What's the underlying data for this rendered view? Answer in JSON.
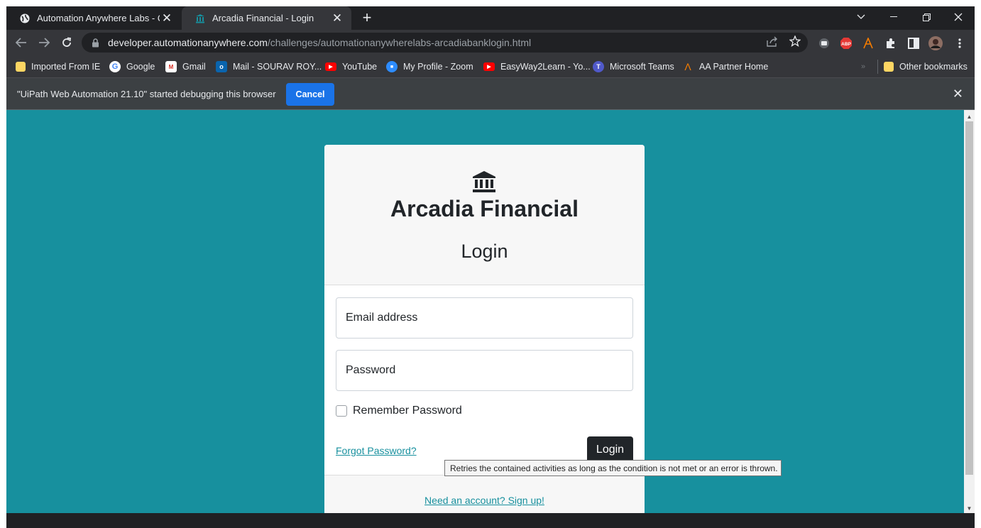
{
  "tabs": [
    {
      "title": "Automation Anywhere Labs - Qu",
      "icon": "globe-icon",
      "active": false
    },
    {
      "title": "Arcadia Financial - Login",
      "icon": "bank-icon",
      "active": true
    }
  ],
  "toolbar": {
    "url_host": "developer.automationanywhere.com",
    "url_path": "/challenges/automationanywherelabs-arcadiabanklogin.html"
  },
  "bookmarks": [
    {
      "label": "Imported From IE",
      "icon": "folder-icon"
    },
    {
      "label": "Google",
      "icon": "google-icon"
    },
    {
      "label": "Gmail",
      "icon": "gmail-icon"
    },
    {
      "label": "Mail - SOURAV ROY...",
      "icon": "outlook-icon"
    },
    {
      "label": "YouTube",
      "icon": "youtube-icon"
    },
    {
      "label": "My Profile - Zoom",
      "icon": "zoom-icon"
    },
    {
      "label": "EasyWay2Learn - Yo...",
      "icon": "youtube-icon"
    },
    {
      "label": "Microsoft Teams",
      "icon": "teams-icon"
    },
    {
      "label": "AA Partner Home",
      "icon": "aa-logo-icon"
    }
  ],
  "other_bookmarks": "Other bookmarks",
  "debug_bar": {
    "message": "\"UiPath Web Automation 21.10\" started debugging this browser",
    "cancel_label": "Cancel"
  },
  "login": {
    "brand": "Arcadia Financial",
    "title": "Login",
    "email_placeholder": "Email address",
    "password_placeholder": "Password",
    "remember_label": "Remember Password",
    "forgot_label": "Forgot Password?",
    "login_button": "Login",
    "signup_link": "Need an account? Sign up!"
  },
  "tooltip": "Retries the contained activities as long as the condition is not met or an error is thrown.",
  "colors": {
    "page_background": "#17909e",
    "debug_cancel": "#1a73e8",
    "login_button": "#212529"
  }
}
